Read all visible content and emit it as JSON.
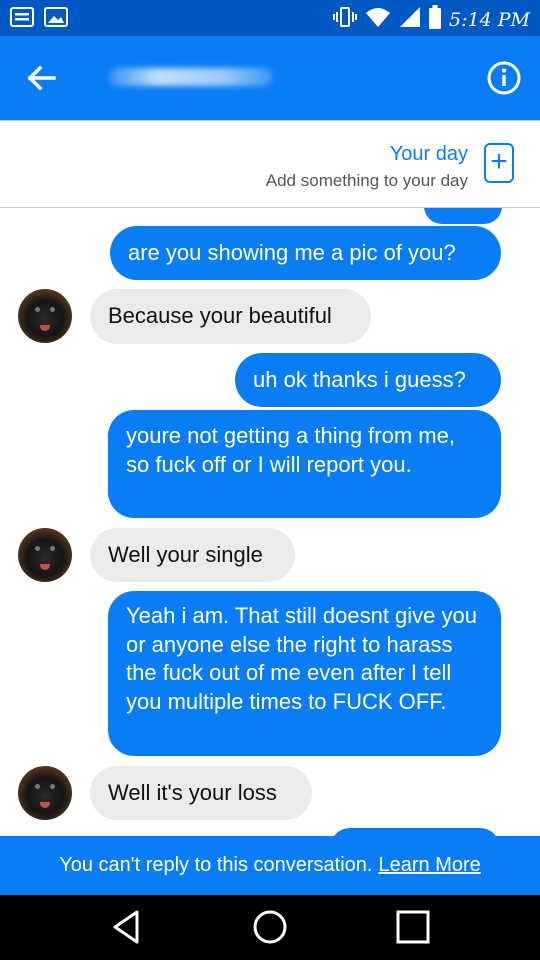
{
  "status_bar": {
    "time": "5:14 PM",
    "icons": [
      "notification-icon",
      "image-icon",
      "vibrate-icon",
      "wifi-icon",
      "signal-icon",
      "battery-icon"
    ]
  },
  "header": {
    "title": "",
    "back_icon": "back-arrow-icon",
    "info_icon": "info-icon"
  },
  "your_day": {
    "title": "Your day",
    "subtitle": "Add something to your day",
    "add_icon": "plus-icon"
  },
  "messages": [
    {
      "from": "me",
      "text": "are you showing me a pic of you?"
    },
    {
      "from": "them",
      "text": "Because your beautiful"
    },
    {
      "from": "me",
      "text": "uh ok thanks i guess?"
    },
    {
      "from": "me",
      "text": "youre not getting a thing from me, so fuck off or I will report you."
    },
    {
      "from": "them",
      "text": "Well your single"
    },
    {
      "from": "me",
      "text": "Yeah i am. That still doesnt give you or anyone else the right to harass the fuck out of me even after I tell you multiple times to FUCK OFF."
    },
    {
      "from": "them",
      "text": "Well it's your loss"
    }
  ],
  "footer": {
    "text": "You can't reply to this conversation.",
    "link": "Learn More"
  },
  "nav": {
    "back_icon": "nav-back-icon",
    "home_icon": "nav-home-icon",
    "recents_icon": "nav-recents-icon"
  },
  "colors": {
    "accent": "#0a7cf4",
    "status_bar": "#0058c4",
    "incoming_bubble": "#ebebeb"
  }
}
